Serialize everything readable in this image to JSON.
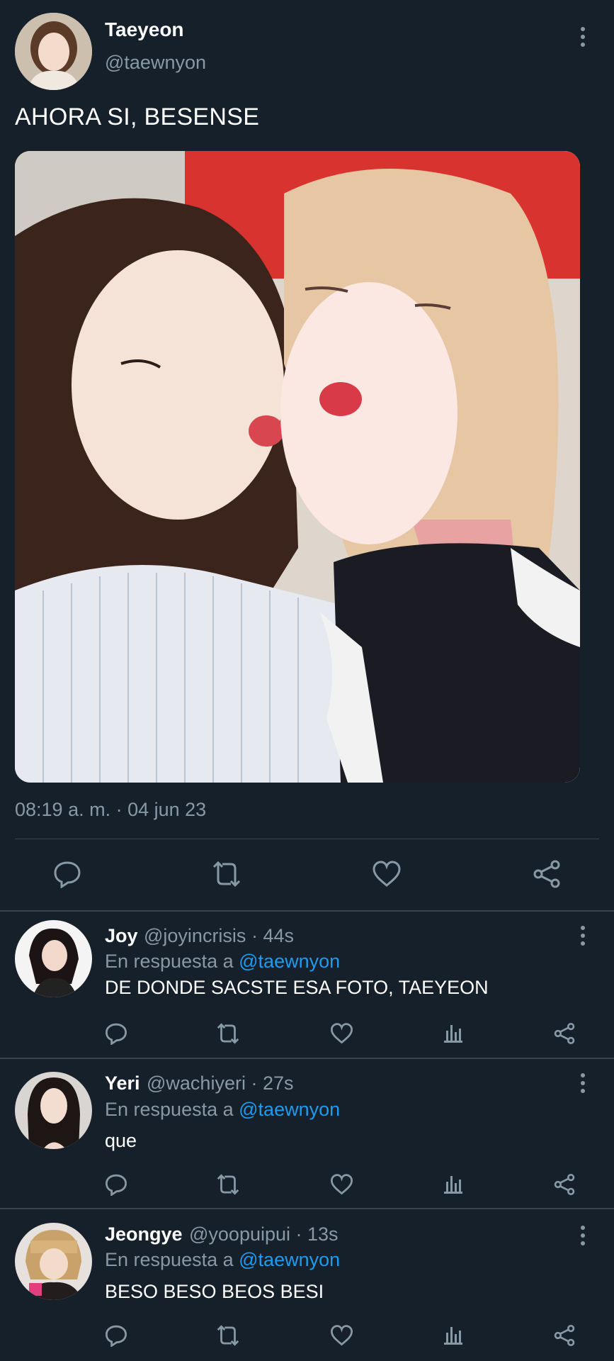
{
  "main_tweet": {
    "display_name": "Taeyeon",
    "handle": "@taewnyon",
    "text": "AHORA SI, BESENSE",
    "timestamp": "08:19 a. m. · 04 jun 23",
    "actions": [
      "reply-icon",
      "retweet-icon",
      "like-icon",
      "share-icon"
    ]
  },
  "replies": [
    {
      "display_name": "Joy",
      "handle": "@joyincrisis",
      "time": "· 44s",
      "in_reply_prefix": "En respuesta a",
      "in_reply_to": "@taewnyon",
      "text": "DE DONDE SACSTE ESA FOTO, TAEYEON"
    },
    {
      "display_name": "Yeri",
      "handle": "@wachiyeri",
      "time": "· 27s",
      "in_reply_prefix": "En respuesta a",
      "in_reply_to": "@taewnyon",
      "text": "que"
    },
    {
      "display_name": "Jeongye",
      "handle": "@yoopuipui",
      "time": "· 13s",
      "in_reply_prefix": "En respuesta a",
      "in_reply_to": "@taewnyon",
      "text": "BESO BESO BEOS BESI"
    }
  ],
  "colors": {
    "background": "#15202b",
    "secondary_text": "#8899a6",
    "mention": "#1d9bf0",
    "divider": "#38444d"
  }
}
